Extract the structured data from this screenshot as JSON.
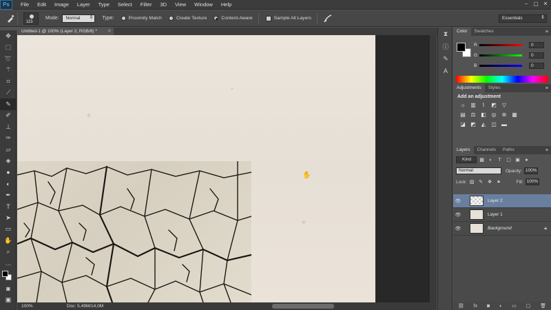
{
  "app": {
    "logo": "Ps",
    "menu": [
      "File",
      "Edit",
      "Image",
      "Layer",
      "Type",
      "Select",
      "Filter",
      "3D",
      "View",
      "Window",
      "Help"
    ],
    "window_controls": [
      "–",
      "▢",
      "✕"
    ]
  },
  "options_bar": {
    "brush_size": "115",
    "mode_label": "Mode:",
    "mode_value": "Normal",
    "type_label": "Type:",
    "type_options": [
      {
        "label": "Proximity Match",
        "selected": false
      },
      {
        "label": "Create Texture",
        "selected": false
      },
      {
        "label": "Content-Aware",
        "selected": true
      }
    ],
    "sample_all_layers": "Sample All Layers",
    "workspace": "Essentials"
  },
  "document": {
    "tab_title": "Untitled-1 @ 100% (Layer 2, RGB/8) *",
    "tab_close": "×"
  },
  "status_bar": {
    "zoom": "100%",
    "doc_info": "Doc: 5,49M/14,0M"
  },
  "color_panel": {
    "tabs": [
      "Color",
      "Swatches"
    ],
    "sliders": [
      {
        "label": "R",
        "value": "0",
        "color": "#e03030"
      },
      {
        "label": "G",
        "value": "0",
        "color": "#30c030"
      },
      {
        "label": "B",
        "value": "0",
        "color": "#3040e0"
      }
    ]
  },
  "adjustments_panel": {
    "tabs": [
      "Adjustments",
      "Styles"
    ],
    "title": "Add an adjustment"
  },
  "layers_panel": {
    "tabs": [
      "Layers",
      "Channels",
      "Paths"
    ],
    "kind": "Kind",
    "blend_mode": "Normal",
    "opacity_label": "Opacity:",
    "opacity_value": "100%",
    "lock_label": "Lock:",
    "fill_label": "Fill:",
    "fill_value": "100%",
    "layers": [
      {
        "name": "Layer 2",
        "selected": true,
        "locked": false
      },
      {
        "name": "Layer 1",
        "selected": false,
        "locked": false
      },
      {
        "name": "Background",
        "selected": false,
        "locked": true
      }
    ],
    "footer_icons": [
      "link-icon",
      "fx-icon",
      "mask-icon",
      "adjustment-icon",
      "folder-icon",
      "new-layer-icon",
      "trash-icon"
    ]
  }
}
